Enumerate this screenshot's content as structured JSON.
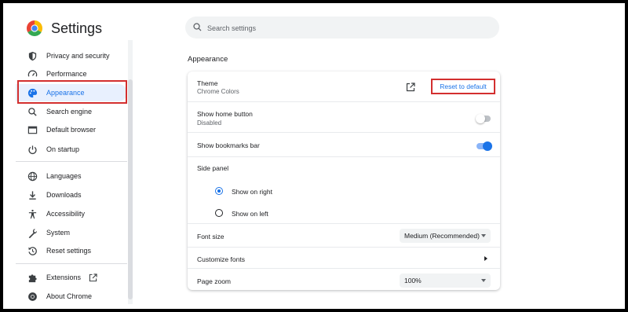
{
  "app": {
    "title": "Settings"
  },
  "search": {
    "placeholder": "Search settings"
  },
  "sidebar": {
    "items": [
      {
        "label": "Privacy and security",
        "icon": "shield-icon"
      },
      {
        "label": "Performance",
        "icon": "speedometer-icon"
      },
      {
        "label": "Appearance",
        "icon": "palette-icon",
        "active": true
      },
      {
        "label": "Search engine",
        "icon": "search-icon"
      },
      {
        "label": "Default browser",
        "icon": "browser-window-icon"
      },
      {
        "label": "On startup",
        "icon": "power-icon"
      },
      {
        "label": "Languages",
        "icon": "globe-icon"
      },
      {
        "label": "Downloads",
        "icon": "download-icon"
      },
      {
        "label": "Accessibility",
        "icon": "accessibility-icon"
      },
      {
        "label": "System",
        "icon": "wrench-icon"
      },
      {
        "label": "Reset settings",
        "icon": "reset-icon"
      },
      {
        "label": "Extensions",
        "icon": "puzzle-icon"
      },
      {
        "label": "About Chrome",
        "icon": "chrome-logo-icon"
      }
    ]
  },
  "main": {
    "section_title": "Appearance",
    "theme": {
      "label": "Theme",
      "value": "Chrome Colors",
      "reset_label": "Reset to default"
    },
    "home_button": {
      "label": "Show home button",
      "value": "Disabled",
      "enabled": false
    },
    "bookmarks_bar": {
      "label": "Show bookmarks bar",
      "enabled": true
    },
    "side_panel": {
      "label": "Side panel",
      "options": [
        {
          "label": "Show on right",
          "selected": true
        },
        {
          "label": "Show on left",
          "selected": false
        }
      ]
    },
    "font_size": {
      "label": "Font size",
      "value": "Medium (Recommended)"
    },
    "customize_fonts": {
      "label": "Customize fonts"
    },
    "page_zoom": {
      "label": "Page zoom",
      "value": "100%"
    }
  },
  "colors": {
    "accent": "#1a73e8",
    "highlight_border": "#d32f2f",
    "active_bg": "#e8f0fe"
  }
}
